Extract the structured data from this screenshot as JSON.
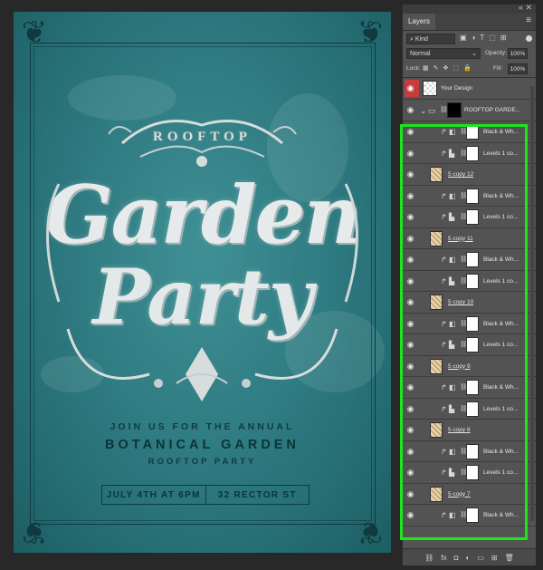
{
  "poster": {
    "rooftop_word": "ROOFTOP",
    "title_line1": "Garden",
    "title_line2": "Party",
    "join_us": "JOIN US FOR THE ANNUAL",
    "botanical": "BOTANICAL GARDEN",
    "rooftop_party": "ROOFTOP PARTY",
    "date": "JULY 4TH AT 6PM",
    "address": "32 RECTOR ST"
  },
  "panel": {
    "tab_title": "Layers",
    "filter_kind": "Kind",
    "blend_mode": "Normal",
    "opacity_label": "Opacity:",
    "opacity_value": "100%",
    "lock_label": "Lock:",
    "fill_label": "Fill:",
    "fill_value": "100%",
    "layers": [
      {
        "name": "Your Design",
        "kind": "smart"
      },
      {
        "name": "ROOFTOP GARDE...",
        "kind": "group"
      },
      {
        "name": "Black & Wh...",
        "kind": "bw"
      },
      {
        "name": "Levels 1 co...",
        "kind": "levels"
      },
      {
        "name": "5 copy 12",
        "kind": "image"
      },
      {
        "name": "Black & Wh...",
        "kind": "bw"
      },
      {
        "name": "Levels 1 co...",
        "kind": "levels"
      },
      {
        "name": "5 copy 11",
        "kind": "image"
      },
      {
        "name": "Black & Wh...",
        "kind": "bw"
      },
      {
        "name": "Levels 1 co...",
        "kind": "levels"
      },
      {
        "name": "5 copy 10",
        "kind": "image"
      },
      {
        "name": "Black & Wh...",
        "kind": "bw"
      },
      {
        "name": "Levels 1 co...",
        "kind": "levels"
      },
      {
        "name": "5 copy 9",
        "kind": "image"
      },
      {
        "name": "Black & Wh...",
        "kind": "bw"
      },
      {
        "name": "Levels 1 co...",
        "kind": "levels"
      },
      {
        "name": "5 copy 8",
        "kind": "image"
      },
      {
        "name": "Black & Wh...",
        "kind": "bw"
      },
      {
        "name": "Levels 1 co...",
        "kind": "levels"
      },
      {
        "name": "5 copy 7",
        "kind": "image"
      },
      {
        "name": "Black & Wh...",
        "kind": "bw"
      }
    ]
  },
  "colors": {
    "poster_teal": "#2f7c82",
    "poster_ink": "#0f3b40",
    "panel_bg": "#535353",
    "highlight": "#1fe51d"
  }
}
